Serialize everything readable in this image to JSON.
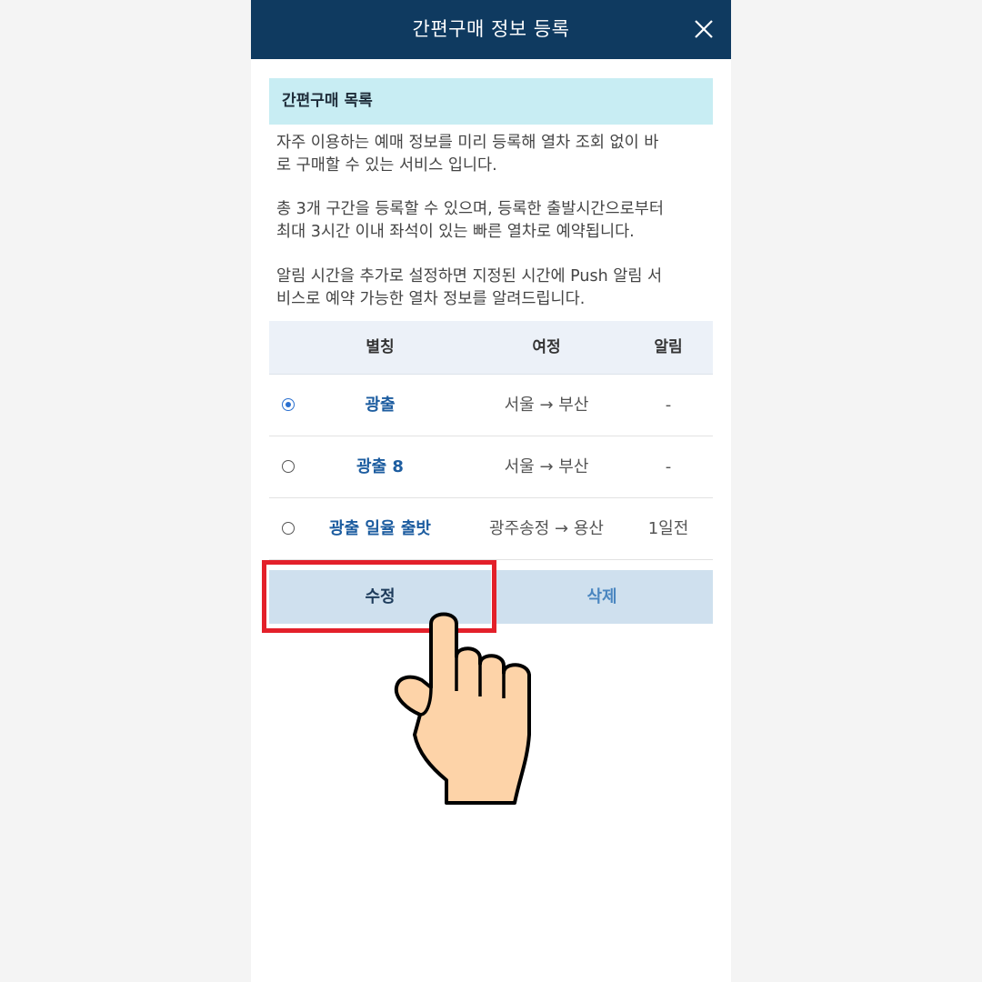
{
  "header": {
    "title": "간편구매 정보 등록",
    "close_icon": "close-icon"
  },
  "section": {
    "heading": "간편구매 목록"
  },
  "descriptions": [
    "자주 이용하는 예매 정보를 미리 등록해 열차 조회 없이 바\n로 구매할 수 있는 서비스 입니다.",
    "총 3개 구간을 등록할 수 있으며, 등록한 출발시간으로부터\n최대 3시간 이내 좌석이 있는 빠른 열차로 예약됩니다.",
    "알림 시간을 추가로 설정하면 지정된 시간에 Push 알림 서\n비스로 예약 가능한 열차 정보를 알려드립니다."
  ],
  "table": {
    "headers": {
      "alias": "별칭",
      "route": "여정",
      "alarm": "알림"
    },
    "rows": [
      {
        "selected": true,
        "alias": "광출",
        "route": "서울 → 부산",
        "alarm": "-"
      },
      {
        "selected": false,
        "alias": "광출 8",
        "route": "서울 → 부산",
        "alarm": "-"
      },
      {
        "selected": false,
        "alias": "광출 일율 출밧",
        "route": "광주송정 → 용산",
        "alarm": "1일전"
      }
    ]
  },
  "buttons": {
    "edit": "수정",
    "delete": "삭제"
  },
  "colors": {
    "header_bg": "#0f3a60",
    "section_bg": "#c8edf3",
    "highlight": "#e3202a",
    "accent": "#2a6fcf"
  },
  "overlay": {
    "pointer_icon": "pointing-hand-icon"
  }
}
